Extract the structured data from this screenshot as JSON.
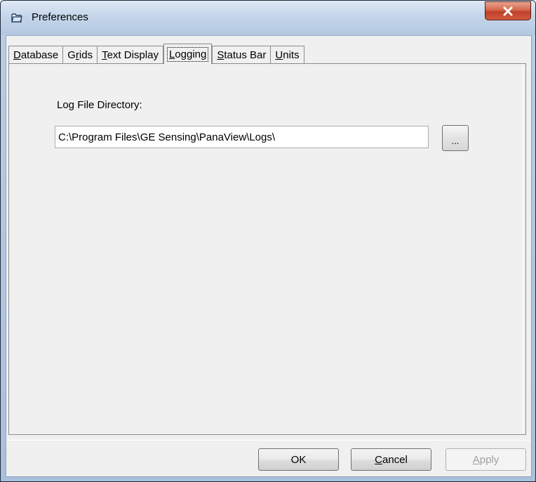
{
  "window": {
    "title": "Preferences",
    "close_glyph": "X"
  },
  "tabs": [
    {
      "label_pre": "",
      "label_ul": "D",
      "label_post": "atabase",
      "active": false
    },
    {
      "label_pre": "G",
      "label_ul": "r",
      "label_post": "ids",
      "active": false
    },
    {
      "label_pre": "",
      "label_ul": "T",
      "label_post": "ext Display",
      "active": false
    },
    {
      "label_pre": "",
      "label_ul": "L",
      "label_post": "ogging",
      "active": true
    },
    {
      "label_pre": "",
      "label_ul": "S",
      "label_post": "tatus Bar",
      "active": false
    },
    {
      "label_pre": "",
      "label_ul": "U",
      "label_post": "nits",
      "active": false
    }
  ],
  "logging": {
    "label": "Log File Directory:",
    "directory_value": "C:\\Program Files\\GE Sensing\\PanaView\\Logs\\",
    "browse_label": "..."
  },
  "buttons": {
    "ok": "OK",
    "cancel_ul": "C",
    "cancel_rest": "ancel",
    "apply_ul": "A",
    "apply_rest": "pply"
  },
  "icons": {
    "title_icon": "folder-icon",
    "close_icon": "close-icon"
  },
  "colors": {
    "close_button": "#c94a2f",
    "titlebar": "#c5d6ea",
    "dialog_bg": "#f0f0f0"
  }
}
